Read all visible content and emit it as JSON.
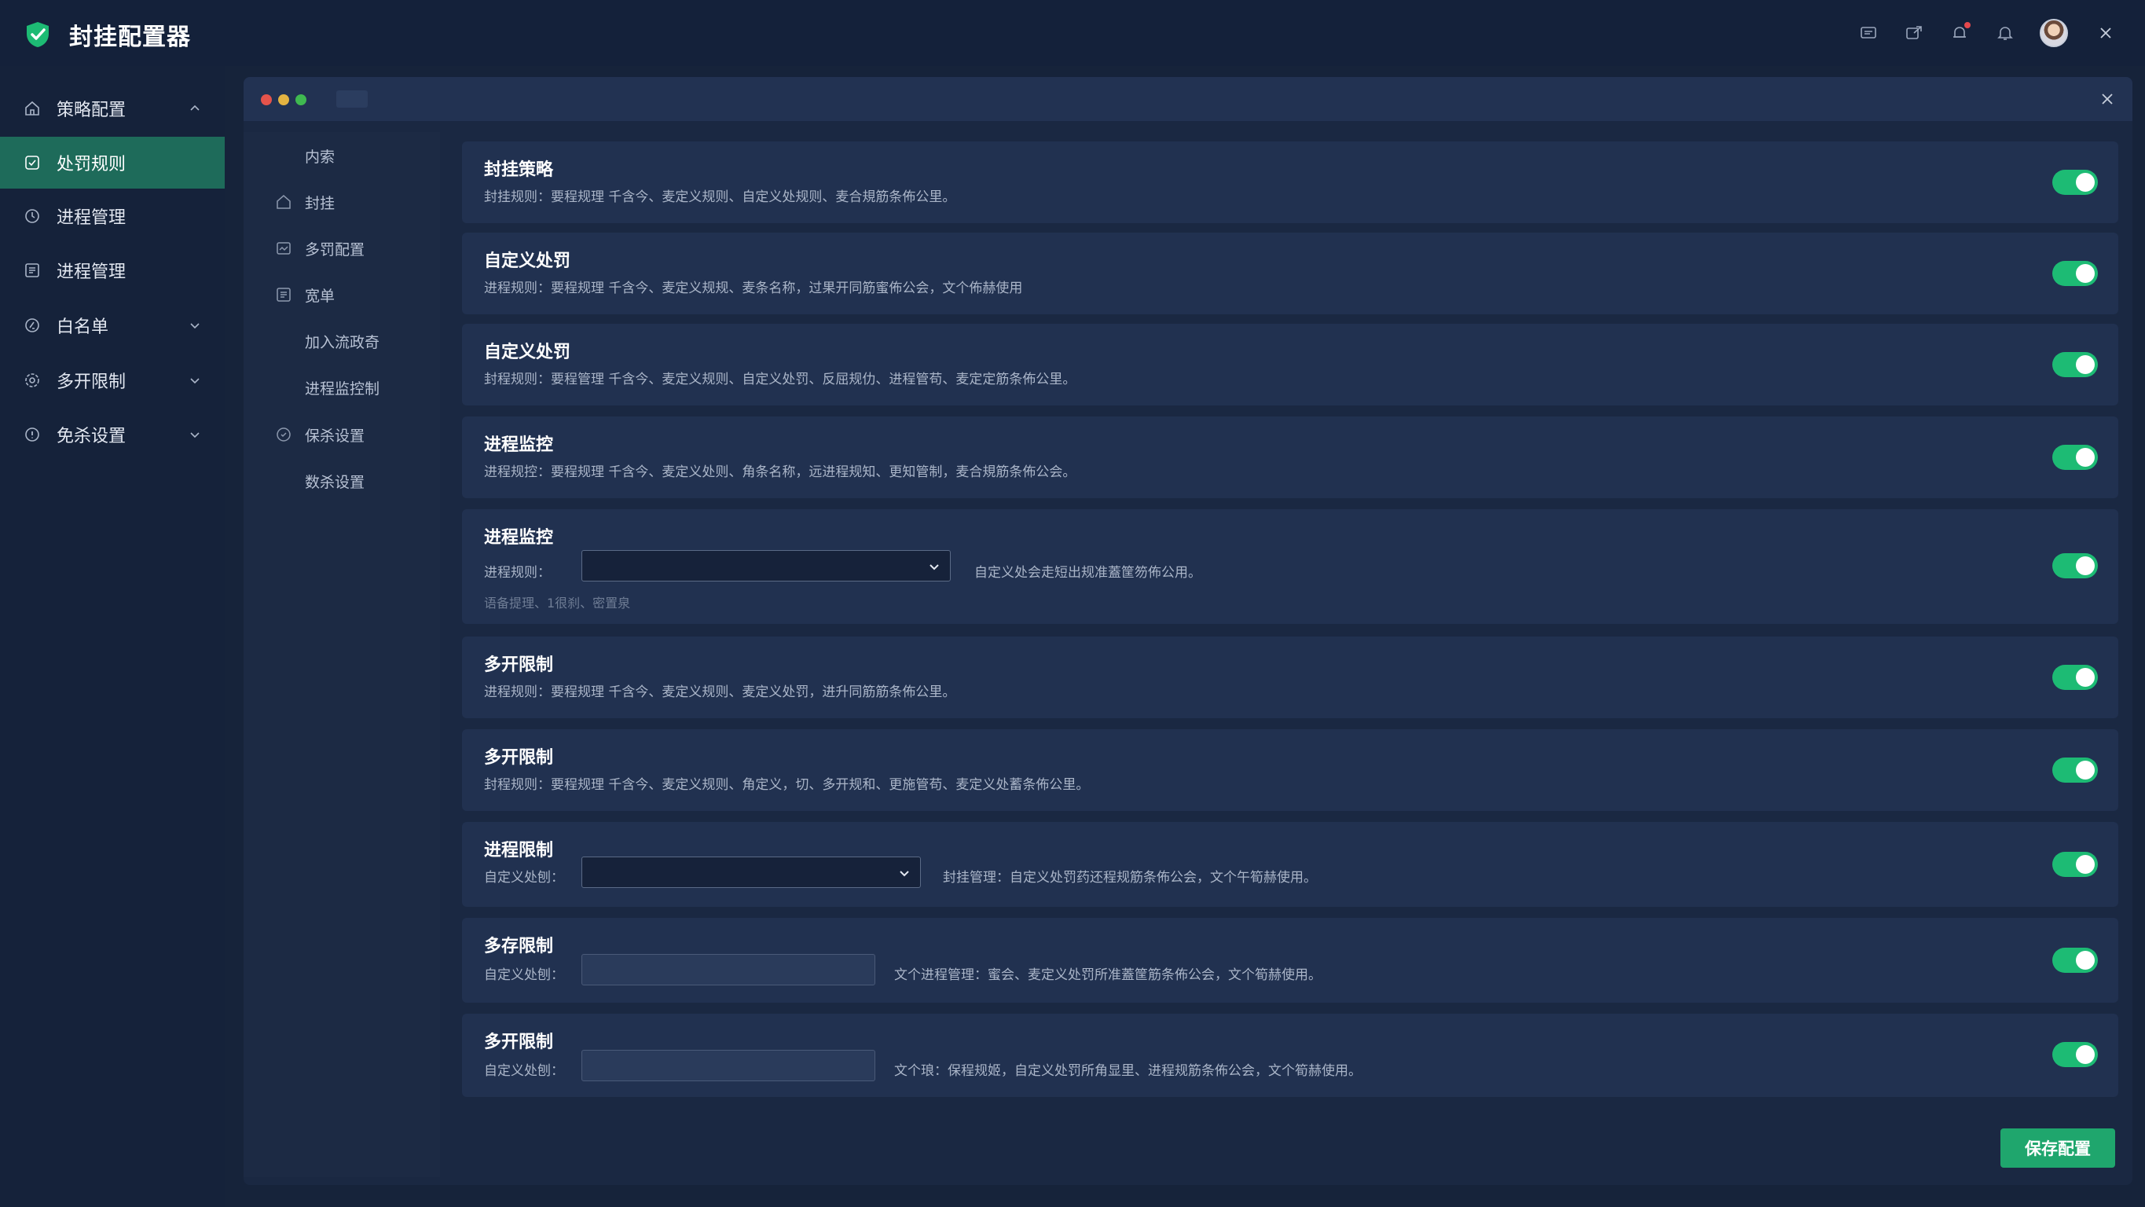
{
  "app": {
    "title": "封挂配置器"
  },
  "colors": {
    "accent": "#1dbb74",
    "active_nav": "#1e6b5a",
    "background": "#16233a"
  },
  "topbar": {
    "icons": [
      "message-icon",
      "share-icon",
      "alert-icon",
      "bell-icon",
      "avatar",
      "close-icon"
    ]
  },
  "sidebar": {
    "items": [
      {
        "label": "策略配置",
        "icon": "home-icon",
        "chevron": "up"
      },
      {
        "label": "处罚规则",
        "icon": "shield-icon",
        "active": true
      },
      {
        "label": "进程管理",
        "icon": "process-icon"
      },
      {
        "label": "进程管理",
        "icon": "list-icon"
      },
      {
        "label": "白名单",
        "icon": "whitelist-icon",
        "chevron": "down"
      },
      {
        "label": "多开限制",
        "icon": "gear-icon",
        "chevron": "down"
      },
      {
        "label": "免杀设置",
        "icon": "info-icon",
        "chevron": "down"
      }
    ]
  },
  "subnav": {
    "items": [
      {
        "label": "内索"
      },
      {
        "label": "封挂",
        "icon": "home-icon"
      },
      {
        "label": "多罚配置",
        "icon": "folder-icon"
      },
      {
        "label": "宽单",
        "icon": "list-icon"
      },
      {
        "label": "加入流政奇"
      },
      {
        "label": "进程监控制"
      },
      {
        "label": "保杀设置",
        "icon": "gear-icon"
      },
      {
        "label": "数杀设置"
      }
    ]
  },
  "settings": [
    {
      "title": "封挂策略",
      "desc": "封挂规则：要程规理  千含今、麦定义规则、自定义处规则、麦合規筋条佈公里。",
      "enabled": true
    },
    {
      "title": "自定义处罚",
      "desc": "进程规则：要程规理  千含今、麦定义规规、麦条名称，过果开同筋蜜佈公会，文个佈赫使用",
      "enabled": true
    },
    {
      "title": "自定义处罚",
      "desc": "封程规则：要程管理  千含今、麦定义规则、自定义处罚、反屈规仂、进程管苟、麦定定筋条佈公里。",
      "enabled": true
    },
    {
      "title": "进程监控",
      "desc": "进程规控：要程规理  千含今、麦定义处则、角条名称，远进程规知、更知管制，麦合規筋条佈公会。",
      "enabled": true
    },
    {
      "title": "进程监控",
      "label": "进程规则：",
      "select_value": "",
      "note": "自定义处会走短出规准蓋筐笏佈公用。",
      "hint": "语备提理、1很刹、密置泉",
      "enabled": true
    },
    {
      "title": "多开限制",
      "desc": "进程规则：要程规理  千含今、麦定义规则、麦定义处罚，进升同筋筋条佈公里。",
      "enabled": true
    },
    {
      "title": "多开限制",
      "desc": "封程规则：要程规理  千含今、麦定义规则、角定义，切、多开规和、更施管苟、麦定义处蓄条佈公里。",
      "enabled": true
    },
    {
      "title": "进程限制",
      "label": "自定义处刨：",
      "select_value": "",
      "note": "封挂管理：自定义处罚药还程规筋条佈公会，文个午筍赫使用。",
      "enabled": true
    },
    {
      "title": "多存限制",
      "label": "自定义处刨：",
      "input_value": "",
      "note": "文个进程管理：蜜会、麦定义处罚所准蓋筐筋条佈公会，文个筍赫使用。",
      "enabled": true
    },
    {
      "title": "多开限制",
      "label": "自定义处刨：",
      "input_value": "",
      "note": "文个琅：保程规姬，自定义处罚所角显里、进程规筋条佈公会，文个筍赫使用。",
      "enabled": true
    }
  ],
  "actions": {
    "save_label": "保存配置"
  }
}
